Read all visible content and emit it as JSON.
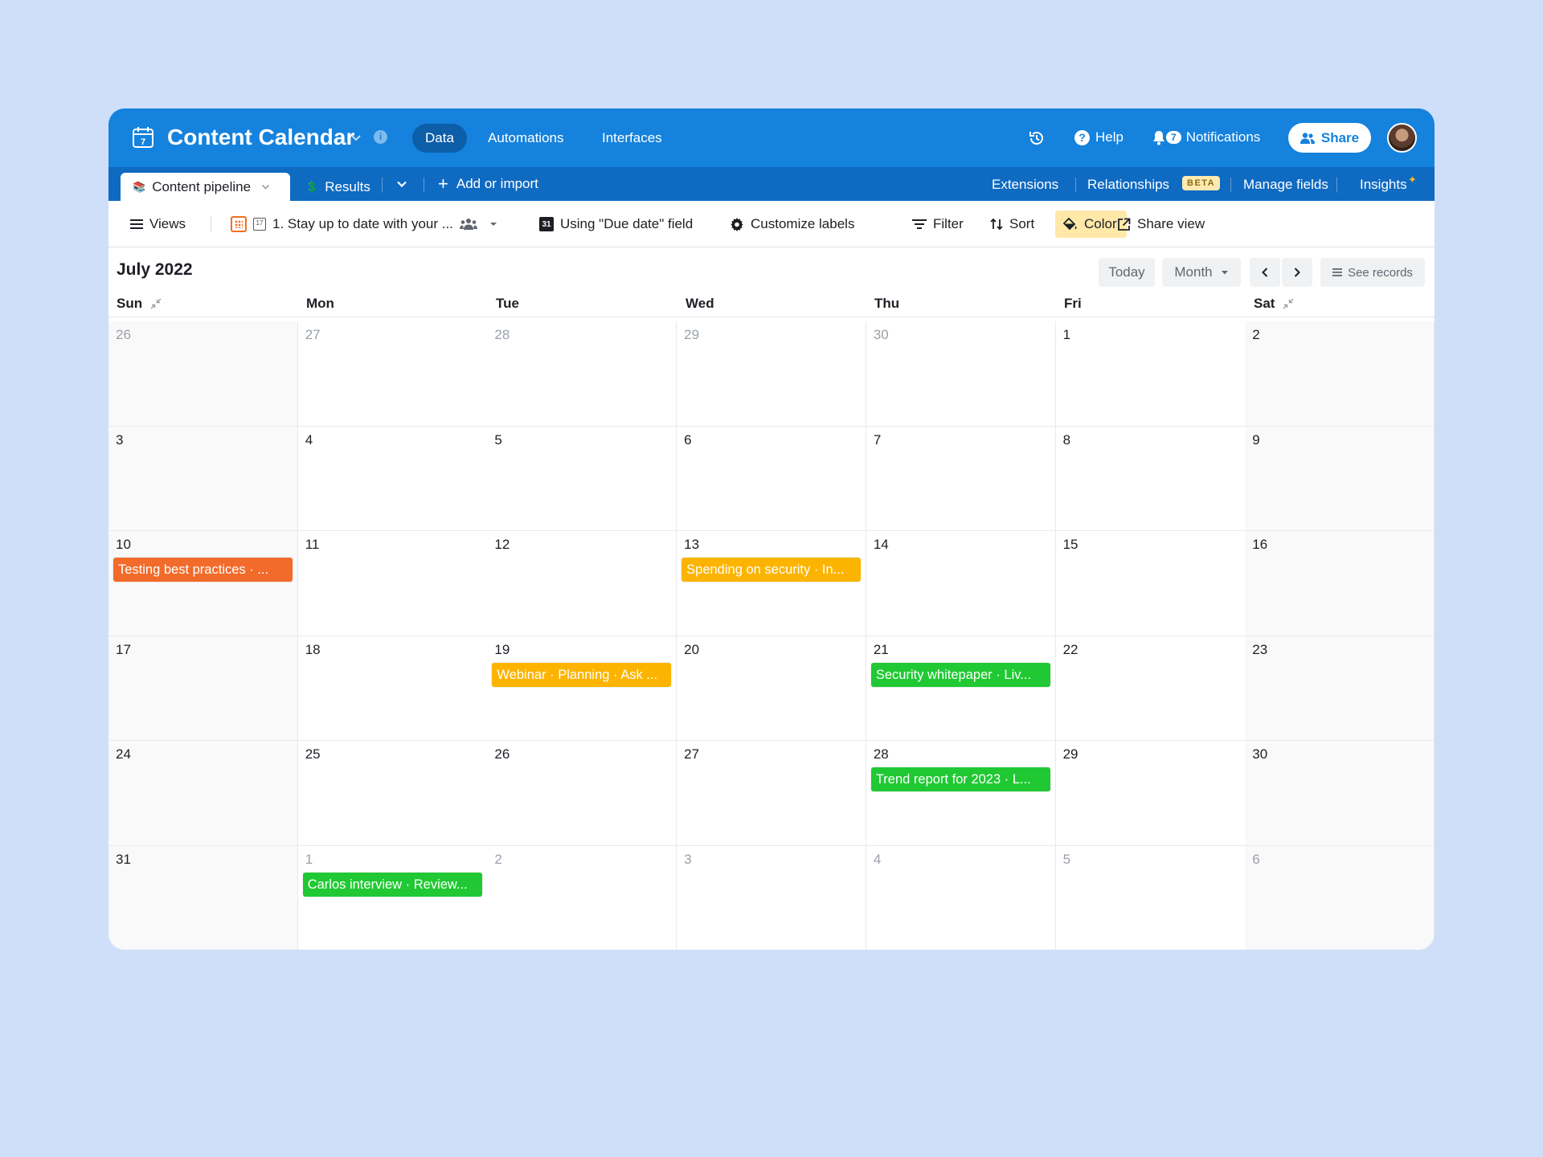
{
  "topbar": {
    "base_title": "Content Calendar",
    "tabs": [
      "Data",
      "Automations",
      "Interfaces"
    ],
    "help_label": "Help",
    "notifications_label": "Notifications",
    "notifications_count": "7",
    "share_label": "Share"
  },
  "tabbar": {
    "tables": [
      {
        "label": "Content pipeline",
        "emoji": "📚"
      },
      {
        "label": "Results",
        "emoji": "💲"
      }
    ],
    "add_label": "Add or import",
    "extensions_label": "Extensions",
    "relationships_label": "Relationships",
    "beta_label": "BETA",
    "manage_fields_label": "Manage fields",
    "insights_label": "Insights"
  },
  "viewbar": {
    "views_label": "Views",
    "view_name": "1. Stay up to date with your ...",
    "date_field_label": "Using \"Due date\" field",
    "customize_label": "Customize labels",
    "filter_label": "Filter",
    "sort_label": "Sort",
    "color_label": "Color",
    "share_view_label": "Share view"
  },
  "calendar": {
    "month_title": "July 2022",
    "today_label": "Today",
    "month_label": "Month",
    "see_records_label": "See records",
    "weekdays": [
      "Sun",
      "Mon",
      "Tue",
      "Wed",
      "Thu",
      "Fri",
      "Sat"
    ],
    "weeks": [
      [
        {
          "d": "26",
          "m": true
        },
        {
          "d": "27",
          "m": true
        },
        {
          "d": "28",
          "m": true
        },
        {
          "d": "29",
          "m": true
        },
        {
          "d": "30",
          "m": true
        },
        {
          "d": "1"
        },
        {
          "d": "2"
        }
      ],
      [
        {
          "d": "3"
        },
        {
          "d": "4"
        },
        {
          "d": "5"
        },
        {
          "d": "6"
        },
        {
          "d": "7"
        },
        {
          "d": "8"
        },
        {
          "d": "9"
        }
      ],
      [
        {
          "d": "10"
        },
        {
          "d": "11"
        },
        {
          "d": "12"
        },
        {
          "d": "13"
        },
        {
          "d": "14"
        },
        {
          "d": "15"
        },
        {
          "d": "16"
        }
      ],
      [
        {
          "d": "17"
        },
        {
          "d": "18"
        },
        {
          "d": "19"
        },
        {
          "d": "20"
        },
        {
          "d": "21"
        },
        {
          "d": "22"
        },
        {
          "d": "23"
        }
      ],
      [
        {
          "d": "24"
        },
        {
          "d": "25"
        },
        {
          "d": "26"
        },
        {
          "d": "27"
        },
        {
          "d": "28"
        },
        {
          "d": "29"
        },
        {
          "d": "30"
        }
      ],
      [
        {
          "d": "31"
        },
        {
          "d": "1",
          "m": true
        },
        {
          "d": "2",
          "m": true
        },
        {
          "d": "3",
          "m": true
        },
        {
          "d": "4",
          "m": true
        },
        {
          "d": "5",
          "m": true
        },
        {
          "d": "6",
          "m": true
        }
      ]
    ],
    "events": [
      {
        "week": 2,
        "day": 0,
        "label": "Testing best practices · ...",
        "color": "#f26b2a"
      },
      {
        "week": 2,
        "day": 3,
        "label": "Spending on security · In...",
        "color": "#fcb400"
      },
      {
        "week": 3,
        "day": 2,
        "label": "Webinar · Planning · Ask ...",
        "color": "#fcb400"
      },
      {
        "week": 3,
        "day": 4,
        "label": "Security whitepaper · Liv...",
        "color": "#20c933"
      },
      {
        "week": 4,
        "day": 4,
        "label": "Trend report for 2023 · L...",
        "color": "#20c933"
      },
      {
        "week": 5,
        "day": 1,
        "label": "Carlos interview · Review...",
        "color": "#20c933"
      }
    ]
  },
  "colors": {
    "topbar": "#1582dd",
    "tabbar": "#0f6ac2",
    "page_background": "#cfdff9",
    "color_button": "#ffe8a8"
  }
}
